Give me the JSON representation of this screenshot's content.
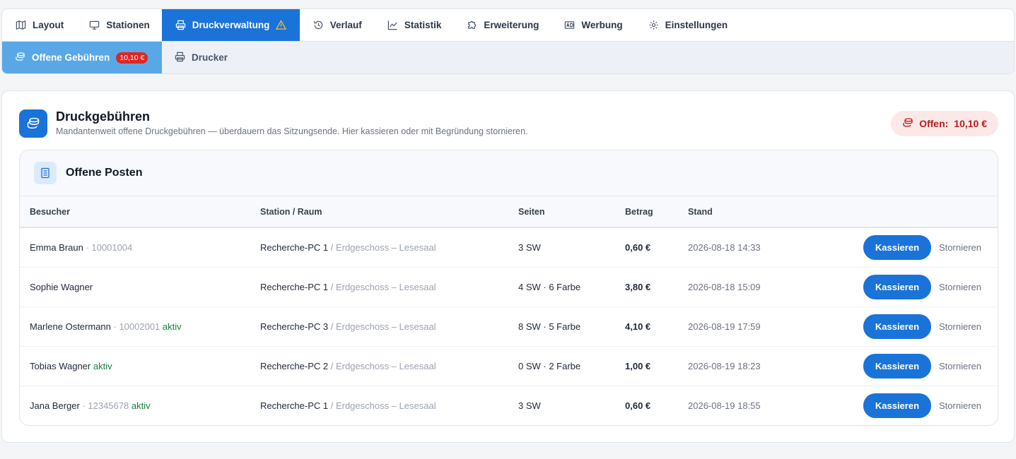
{
  "nav": {
    "tabs": [
      {
        "label": "Layout",
        "icon": "map-icon"
      },
      {
        "label": "Stationen",
        "icon": "monitor-icon"
      },
      {
        "label": "Druckverwaltung",
        "icon": "printer-icon",
        "active": true,
        "warning": true
      },
      {
        "label": "Verlauf",
        "icon": "history-icon"
      },
      {
        "label": "Statistik",
        "icon": "chart-icon"
      },
      {
        "label": "Erweiterung",
        "icon": "puzzle-icon"
      },
      {
        "label": "Werbung",
        "icon": "ad-icon"
      },
      {
        "label": "Einstellungen",
        "icon": "gear-icon"
      }
    ],
    "subtabs": [
      {
        "label": "Offene Gebühren",
        "badge": "10,10 €",
        "icon": "coins-icon",
        "active": true
      },
      {
        "label": "Drucker",
        "icon": "printer-icon"
      }
    ]
  },
  "panel": {
    "title": "Druckgebühren",
    "subtitle": "Mandantenweit offene Druckgebühren — überdauern das Sitzungsende. Hier kassieren oder mit Begründung stornieren.",
    "open_label": "Offen:",
    "open_amount": "10,10 €"
  },
  "card": {
    "title": "Offene Posten",
    "columns": [
      "Besucher",
      "Station / Raum",
      "Seiten",
      "Betrag",
      "Stand"
    ],
    "rows": [
      {
        "name": "Emma Braun",
        "card_id": " · 10001004",
        "status": "",
        "station": "Recherche-PC 1",
        "room": " / Erdgeschoss – Lesesaal",
        "pages": "3 SW",
        "amount": "0,60 €",
        "date": "2026-08-18 14:33"
      },
      {
        "name": "Sophie Wagner",
        "card_id": "",
        "status": "",
        "station": "Recherche-PC 1",
        "room": " / Erdgeschoss – Lesesaal",
        "pages": "4 SW · 6 Farbe",
        "amount": "3,80 €",
        "date": "2026-08-18 15:09"
      },
      {
        "name": "Marlene Ostermann",
        "card_id": " · 10002001",
        "status": " aktiv",
        "station": "Recherche-PC 3",
        "room": " / Erdgeschoss – Lesesaal",
        "pages": "8 SW · 5 Farbe",
        "amount": "4,10 €",
        "date": "2026-08-19 17:59"
      },
      {
        "name": "Tobias Wagner",
        "card_id": "",
        "status": " aktiv",
        "station": "Recherche-PC 2",
        "room": " / Erdgeschoss – Lesesaal",
        "pages": "0 SW · 2 Farbe",
        "amount": "1,00 €",
        "date": "2026-08-19 18:23"
      },
      {
        "name": "Jana Berger",
        "card_id": " · 12345678",
        "status": " aktiv",
        "station": "Recherche-PC 1",
        "room": " / Erdgeschoss – Lesesaal",
        "pages": "3 SW",
        "amount": "0,60 €",
        "date": "2026-08-19 18:55"
      }
    ],
    "pay_label": "Kassieren",
    "cancel_label": "Stornieren"
  },
  "colors": {
    "accent": "#1a73d9",
    "danger": "#dc2626",
    "active": "#15803d"
  }
}
